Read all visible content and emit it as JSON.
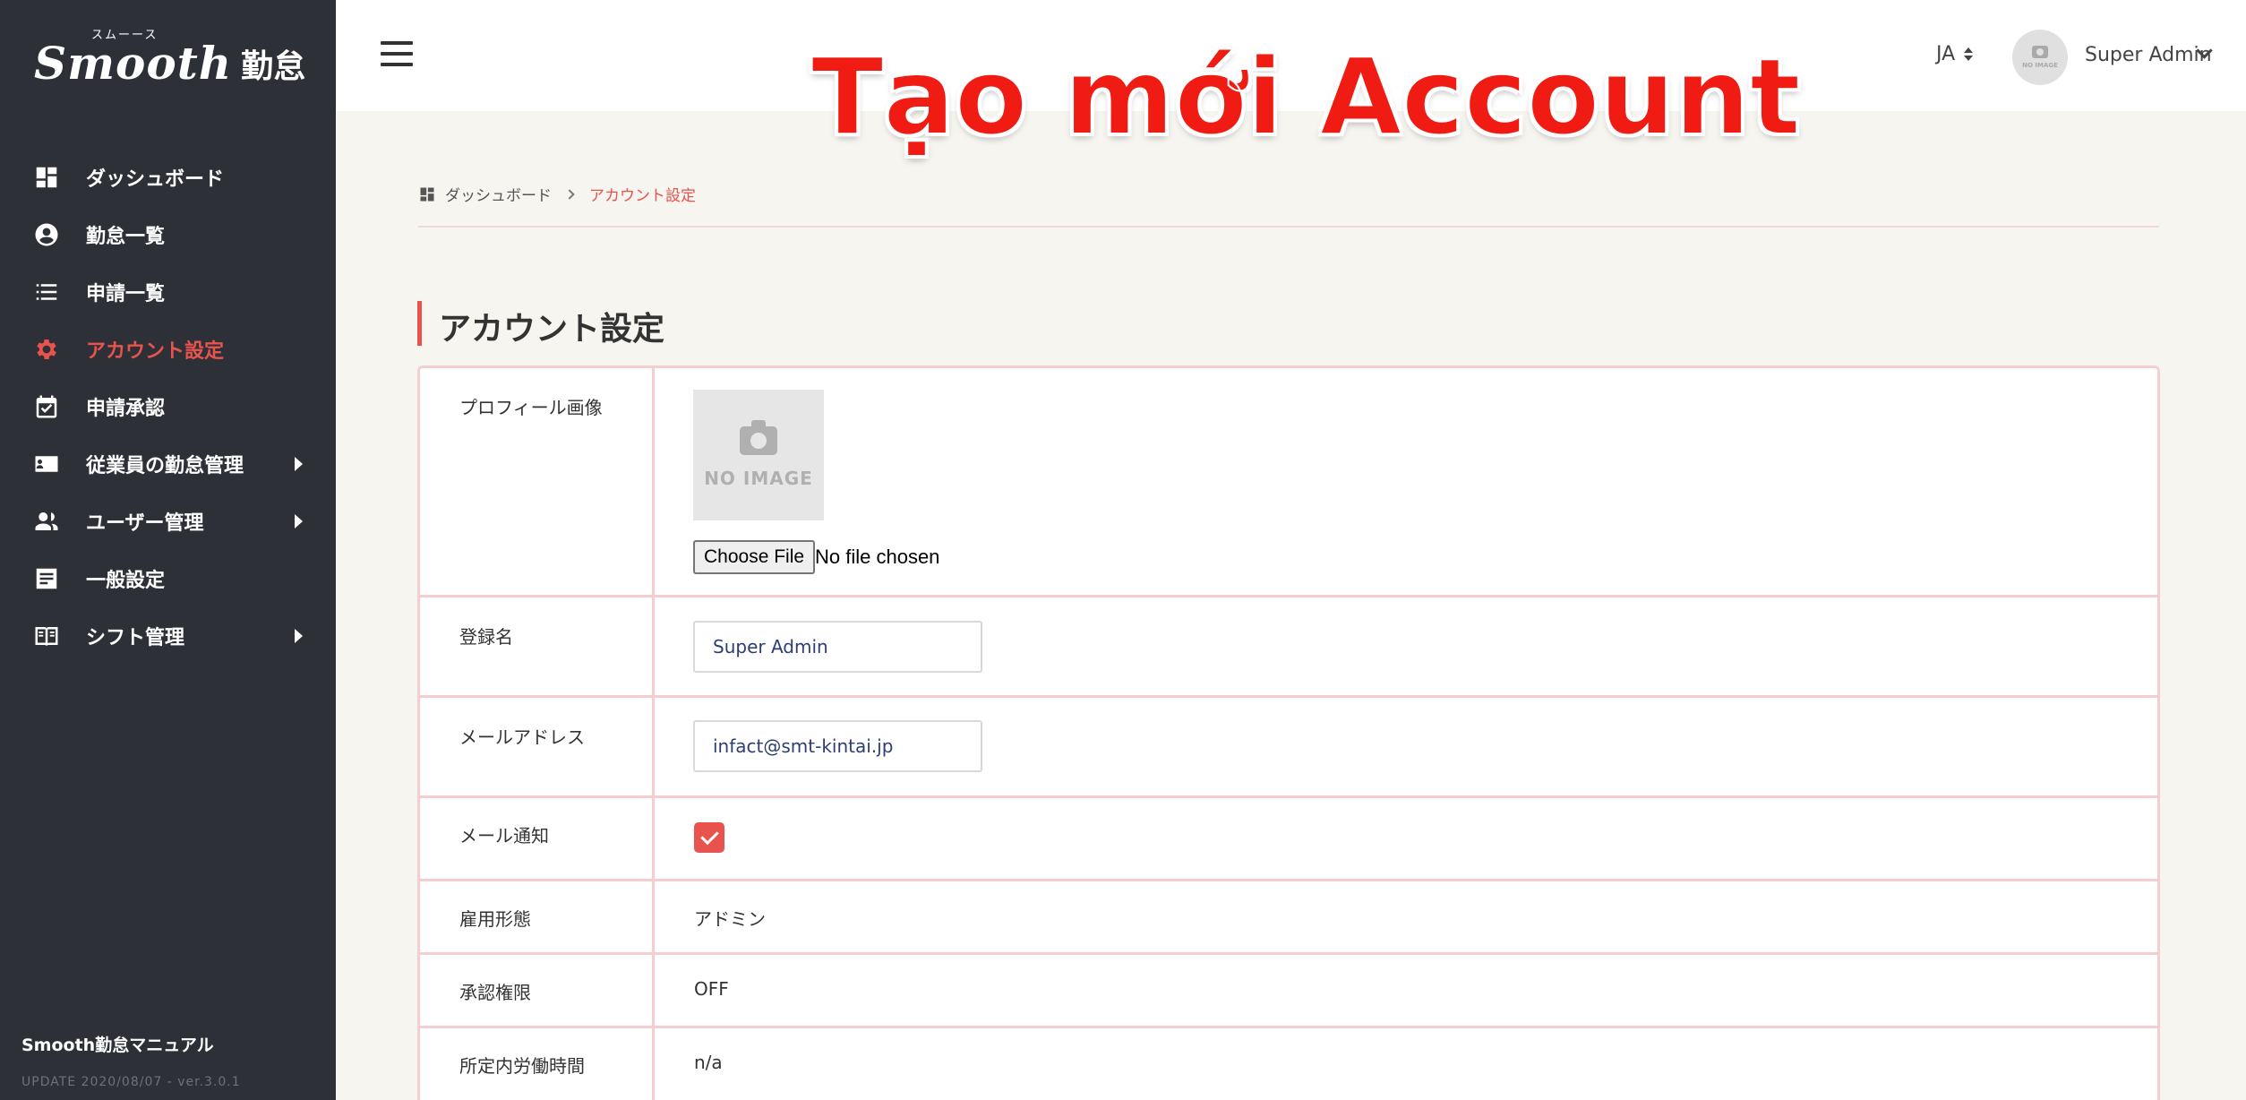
{
  "sidebar": {
    "logo_en": "Smooth",
    "logo_kana": "スムーース",
    "logo_jp": "勤怠",
    "items": [
      {
        "label": "ダッシュボード",
        "icon": "dashboard-icon"
      },
      {
        "label": "勤怠一覧",
        "icon": "user-circle-icon"
      },
      {
        "label": "申請一覧",
        "icon": "list-icon"
      },
      {
        "label": "アカウント設定",
        "icon": "gear-icon",
        "active": true
      },
      {
        "label": "申請承認",
        "icon": "calendar-check-icon"
      },
      {
        "label": "従業員の勤怠管理",
        "icon": "id-card-icon",
        "expandable": true
      },
      {
        "label": "ユーザー管理",
        "icon": "users-icon",
        "expandable": true
      },
      {
        "label": "一般設定",
        "icon": "settings-card-icon"
      },
      {
        "label": "シフト管理",
        "icon": "book-icon",
        "expandable": true
      }
    ],
    "manual": "Smooth勤怠マニュアル",
    "update": "UPDATE 2020/08/07 - ver.3.0.1"
  },
  "header": {
    "lang": "JA",
    "user_name": "Super Admin",
    "avatar_text": "NO IMAGE"
  },
  "overlay_title": "Tạo mới Account",
  "breadcrumb": {
    "home": "ダッシュボード",
    "current": "アカウント設定"
  },
  "page_title": "アカウント設定",
  "form": {
    "profile_image": {
      "label": "プロフィール画像",
      "no_image": "NO IMAGE",
      "choose_file": "Choose File",
      "no_file": "No file chosen"
    },
    "name": {
      "label": "登録名",
      "value": "Super Admin"
    },
    "email": {
      "label": "メールアドレス",
      "value": "infact@smt-kintai.jp"
    },
    "mail_notify": {
      "label": "メール通知",
      "checked": true
    },
    "employment": {
      "label": "雇用形態",
      "value": "アドミン"
    },
    "approval": {
      "label": "承認権限",
      "value": "OFF"
    },
    "working_hours": {
      "label": "所定内労働時間",
      "value": "n/a"
    }
  },
  "colors": {
    "accent": "#e8534e",
    "sidebar_bg": "#2d3036",
    "border": "#f5cfcf"
  }
}
